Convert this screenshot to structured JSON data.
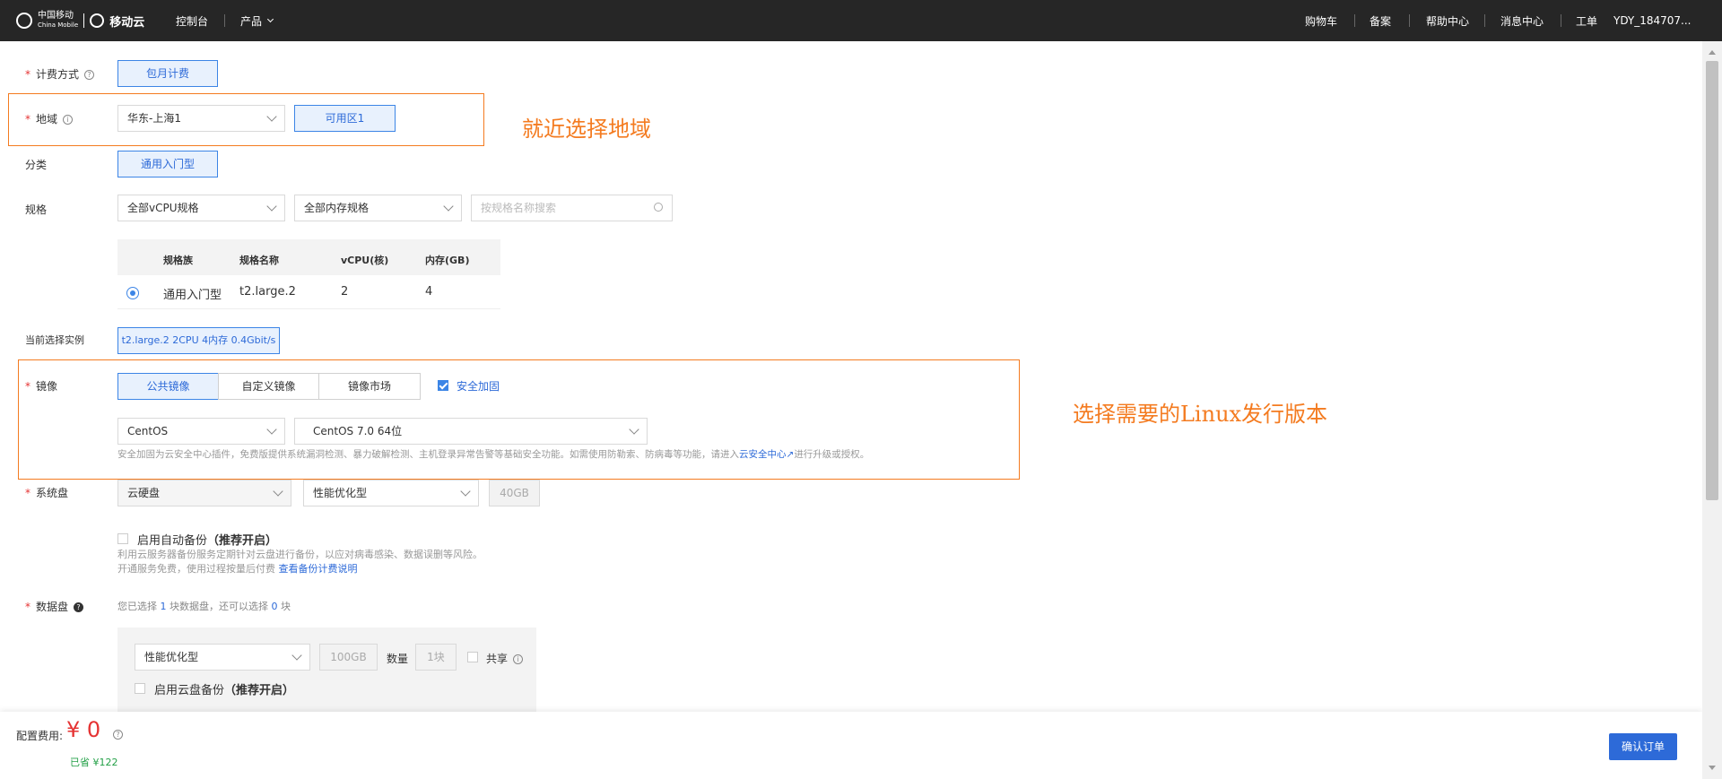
{
  "topbar": {
    "logo_cn": "中国移动",
    "logo_en": "China Mobile",
    "brand": "移动云",
    "console": "控制台",
    "product": "产品",
    "cart": "购物车",
    "filing": "备案",
    "help": "帮助中心",
    "messages": "消息中心",
    "ticket": "工单",
    "user": "YDY_184707..."
  },
  "billing": {
    "label": "计费方式",
    "option": "包月计费"
  },
  "region": {
    "label": "地域",
    "value": "华东-上海1",
    "zone": "可用区1"
  },
  "category": {
    "label": "分类",
    "option": "通用入门型"
  },
  "spec": {
    "label": "规格",
    "vcpu_filter": "全部vCPU规格",
    "mem_filter": "全部内存规格",
    "search_placeholder": "按规格名称搜索",
    "table": {
      "headers": [
        "规格族",
        "规格名称",
        "vCPU(核)",
        "内存(GB)"
      ],
      "rows": [
        [
          "通用入门型",
          "t2.large.2",
          "2",
          "4"
        ]
      ]
    }
  },
  "current": {
    "label": "当前选择实例",
    "value": "t2.large.2 2CPU 4内存 0.4Gbit/s"
  },
  "image": {
    "label": "镜像",
    "tabs": [
      "公共镜像",
      "自定义镜像",
      "镜像市场"
    ],
    "security_check": "安全加固",
    "os": "CentOS",
    "version": "CentOS 7.0 64位",
    "desc": "安全加固为云安全中心插件，免费版提供系统漏洞检测、暴力破解检测、主机登录异常告警等基础安全功能。如需使用防勒索、防病毒等功能，请进入",
    "desc_link": "云安全中心",
    "desc_tail": "进行升级或授权。"
  },
  "system_disk": {
    "label": "系统盘",
    "type": "云硬盘",
    "perf": "性能优化型",
    "size": "40GB",
    "backup_label": "启用自动备份",
    "backup_rec": "（推荐开启）",
    "backup_desc1": "利用云服务器备份服务定期针对云盘进行备份，以应对病毒感染、数据误删等风险。",
    "backup_desc2": "开通服务免费，使用过程按量后付费",
    "backup_link": "查看备份计费说明"
  },
  "data_disk": {
    "label": "数据盘",
    "info_prefix": "您已选择",
    "info_count": "1",
    "info_mid": "块数据盘，还可以选择",
    "info_remain": "0",
    "info_suffix": "块",
    "type": "性能优化型",
    "size": "100GB",
    "qty_label": "数量",
    "qty": "1块",
    "share": "共享",
    "backup_label": "启用云盘备份",
    "backup_rec": "（推荐开启）"
  },
  "footer": {
    "fee_label": "配置费用:",
    "price": "¥ 0",
    "saved": "已省  ¥122",
    "confirm": "确认订单"
  },
  "annotations": {
    "region_note": "就近选择地域",
    "image_note": "选择需要的Linux发行版本"
  },
  "colors": {
    "accent": "#3c85e6",
    "highlight": "#f47b20",
    "price": "#e53333",
    "saved": "#23a047"
  }
}
